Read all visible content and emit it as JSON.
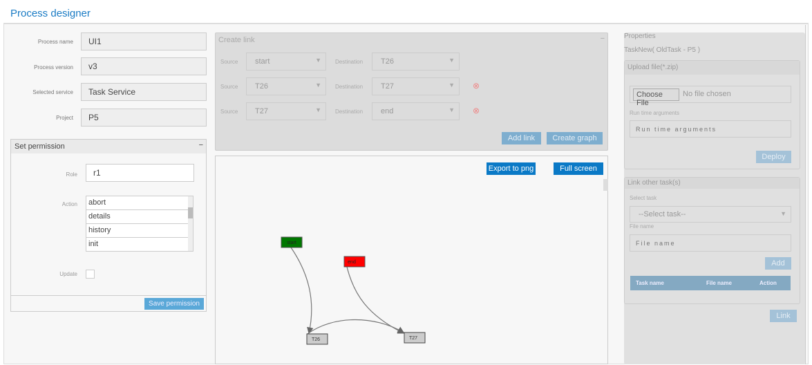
{
  "header": {
    "title": "Process designer"
  },
  "form": {
    "process_name": {
      "label": "Process name",
      "value": "UI1"
    },
    "process_version": {
      "label": "Process version",
      "value": "v3"
    },
    "selected_service": {
      "label": "Selected service",
      "value": "Task Service"
    },
    "project": {
      "label": "Project",
      "value": "P5"
    }
  },
  "permission": {
    "title": "Set permission",
    "collapse": "−",
    "role_label": "Role",
    "role_value": "r1",
    "action_label": "Action",
    "actions": [
      "abort",
      "details",
      "history",
      "init"
    ],
    "update_label": "Update",
    "save": "Save permission"
  },
  "create_link": {
    "title": "Create link",
    "collapse": "−",
    "source_label": "Source",
    "destination_label": "Destination",
    "rows": [
      {
        "source": "start",
        "destination": "T26"
      },
      {
        "source": "T26",
        "destination": "T27"
      },
      {
        "source": "T27",
        "destination": "end"
      }
    ],
    "add_link": "Add link",
    "create_graph": "Create graph"
  },
  "graph": {
    "export": "Export to png",
    "fullscreen": "Full screen",
    "nodes": [
      {
        "id": "start",
        "color": "#007700"
      },
      {
        "id": "end",
        "color": "#ff0000"
      },
      {
        "id": "T26",
        "color": "#cccccc"
      },
      {
        "id": "T27",
        "color": "#cccccc"
      }
    ],
    "edges": [
      [
        "start",
        "T26"
      ],
      [
        "T26",
        "T27"
      ],
      [
        "end",
        "T27"
      ]
    ]
  },
  "properties": {
    "title": "Properties",
    "task": "TaskNew( OldTask - P5 )",
    "upload": {
      "title": "Upload file(*.zip)",
      "choose": "Choose File",
      "no_file": "No file chosen",
      "args_label": "Run time arguments",
      "args_placeholder": "Run time arguments",
      "deploy": "Deploy"
    },
    "link_other": {
      "title": "Link other task(s)",
      "select_label": "Select task",
      "select_value": "--Select task--",
      "file_label": "File name",
      "file_placeholder": "File name",
      "add": "Add",
      "columns": [
        "Task name",
        "File name",
        "Action"
      ]
    },
    "link": "Link"
  }
}
